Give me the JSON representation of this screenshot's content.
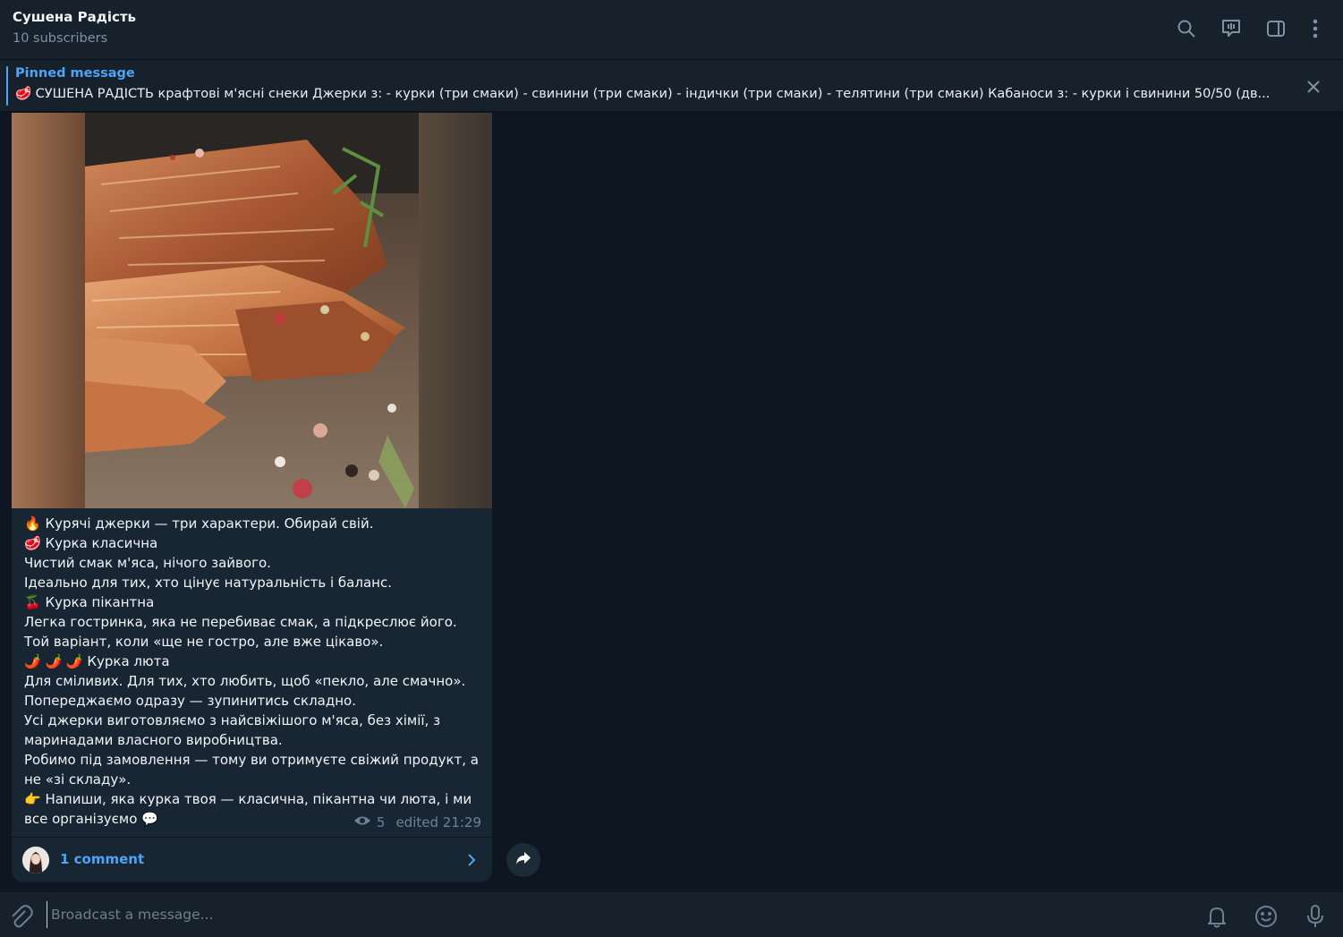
{
  "header": {
    "title": "Сушена Радість",
    "subtitle": "10 subscribers",
    "icons": [
      "search-icon",
      "live-chat-icon",
      "sidebar-toggle-icon",
      "more-vertical-icon"
    ]
  },
  "pinned": {
    "title": "Pinned message",
    "text": "🥩 СУШЕНА РАДІСТЬ  крафтові м'ясні снеки Джерки з:  - курки (три смаки) - свинини (три смаки) - індички (три смаки) - телятини (три смаки) Кабаноси з: - курки і свинини 50/50 (дв..."
  },
  "message": {
    "lines": [
      "🔥 Курячі джерки — три характери. Обирай свій.",
      "🥩 Курка класична",
      "Чистий смак м'яса, нічого зайвого.",
      "Ідеально для тих, хто цінує натуральність і баланс.",
      "🍒 Курка пікантна",
      "Легка гостринка, яка не перебиває смак, а підкреслює його.",
      "Той варіант, коли «ще не гостро, але вже цікаво».",
      "🌶️ 🌶️ 🌶️ Курка люта",
      "Для сміливих. Для тих, хто любить, щоб «пекло, але смачно».",
      "Попереджаємо одразу — зупинитись складно.",
      "Усі джерки виготовляємо з найсвіжішого м'яса, без хімії, з маринадами власного виробництва.",
      "Робимо під замовлення — тому ви отримуєте свіжий продукт, а не «зі складу».",
      "👉 Напиши, яка курка твоя — класична, пікантна чи люта, і ми все організуємо 💬"
    ],
    "views": "5",
    "edited": "edited 21:29",
    "comments_label": "1 comment"
  },
  "composer": {
    "placeholder": "Broadcast a message..."
  },
  "colors": {
    "background": "#0e1621",
    "panel": "#17212b",
    "bubble": "#182533",
    "accent": "#4ea4f6",
    "muted": "#6d8297"
  }
}
